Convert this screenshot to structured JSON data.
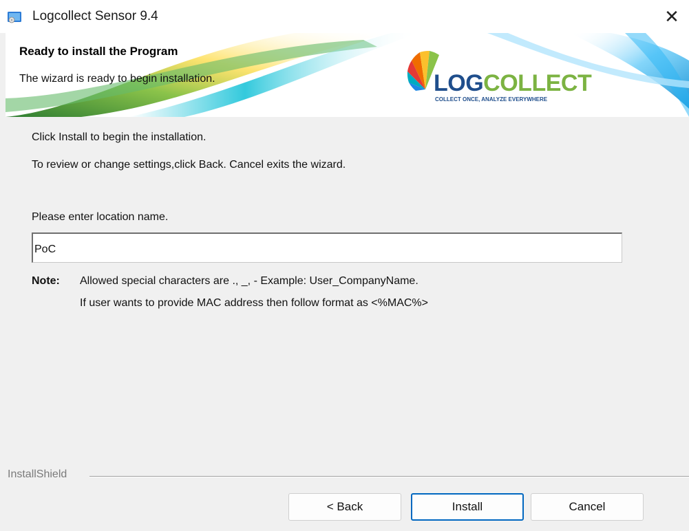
{
  "window": {
    "title": "Logcollect Sensor 9.4",
    "close_glyph": "✕"
  },
  "banner": {
    "title": "Ready to install the Program",
    "subtitle": "The wizard is ready to begin installation.",
    "logo": {
      "text_log": "LOG",
      "text_collect": "COLLECT",
      "tagline": "COLLECT ONCE, ANALYZE EVERYWHERE"
    }
  },
  "content": {
    "line1": "Click Install to begin the installation.",
    "line2": "To review or change settings,click Back. Cancel exits the wizard.",
    "location_label": "Please enter location name.",
    "location_value": "PoC",
    "note_label": "Note:",
    "note_line1": "Allowed special characters are ., _, -  Example: User_CompanyName.",
    "note_line2": "If user wants to provide MAC address then follow format as <%MAC%>"
  },
  "footer": {
    "brand": "InstallShield",
    "back_label": "< Back",
    "install_label": "Install",
    "cancel_label": "Cancel"
  },
  "colors": {
    "accent": "#0067c0",
    "logo_blue": "#1f4e8c",
    "logo_green": "#7cb342"
  }
}
